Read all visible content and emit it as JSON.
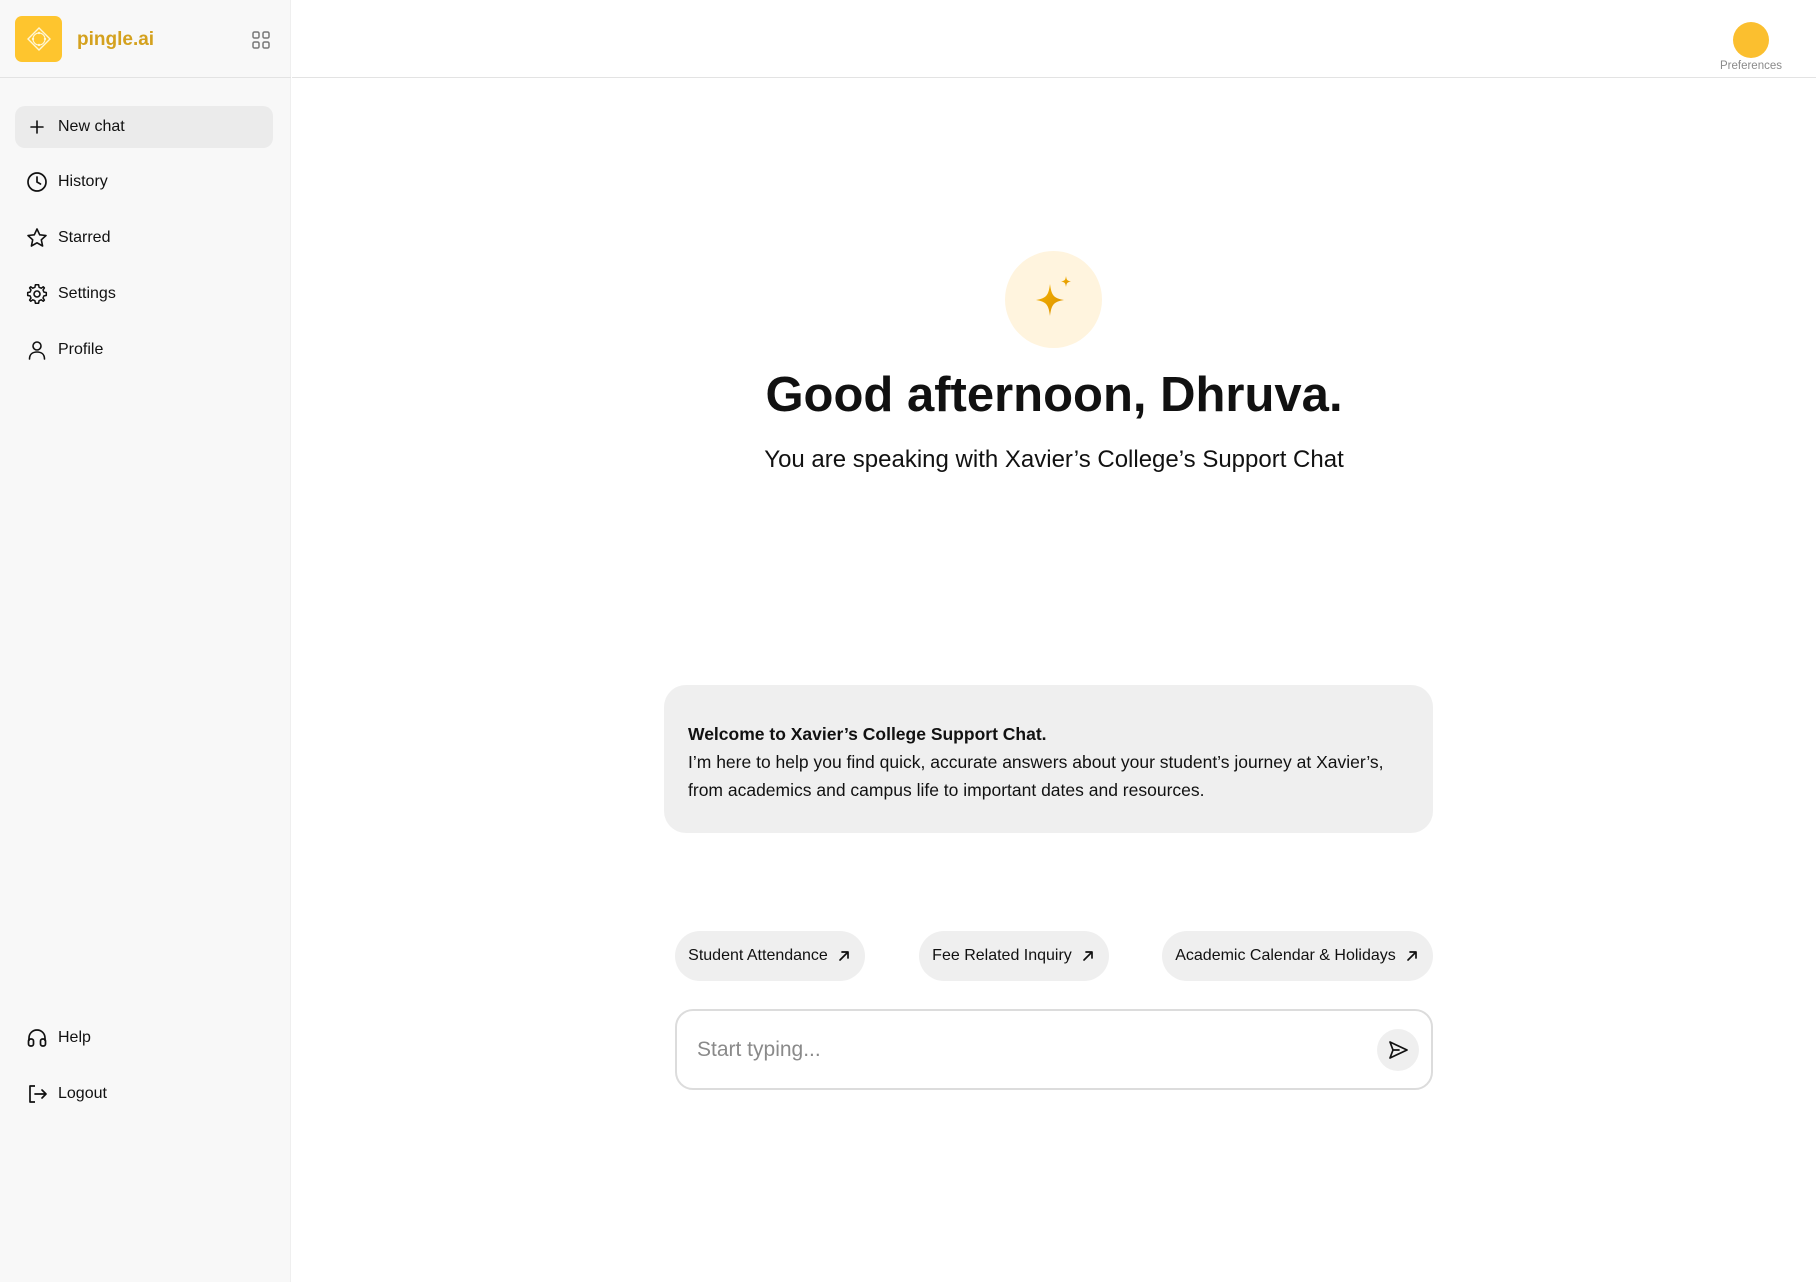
{
  "sidebar": {
    "brand": "pingle.ai",
    "primary_items": [
      {
        "label": "New chat",
        "icon": "plus-icon"
      },
      {
        "label": "History",
        "icon": "clock-icon"
      },
      {
        "label": "Starred",
        "icon": "star-icon"
      },
      {
        "label": "Settings",
        "icon": "gear-icon"
      },
      {
        "label": "Profile",
        "icon": "user-icon"
      }
    ],
    "bottom_items": [
      {
        "label": "Help",
        "icon": "headphones-icon"
      },
      {
        "label": "Logout",
        "icon": "logout-icon"
      }
    ]
  },
  "topbar": {
    "preferences_label": "Preferences"
  },
  "hero": {
    "greeting": "Good afternoon, Dhruva.",
    "subtitle": "You are speaking with Xavier’s College’s Support Chat"
  },
  "welcome": {
    "title": "Welcome to Xavier’s College Support Chat.",
    "body": "I’m here to help you find quick, accurate answers about your student’s journey at Xavier’s, from academics and campus life to important dates and resources."
  },
  "suggestions": [
    {
      "label": "Student Attendance"
    },
    {
      "label": "Fee Related Inquiry"
    },
    {
      "label": "Academic Calendar & Holidays"
    }
  ],
  "composer": {
    "placeholder": "Start typing...",
    "value": ""
  },
  "colors": {
    "accent": "#fec52e",
    "brand_text": "#d4a11e",
    "sparkle": "#e0a000"
  }
}
